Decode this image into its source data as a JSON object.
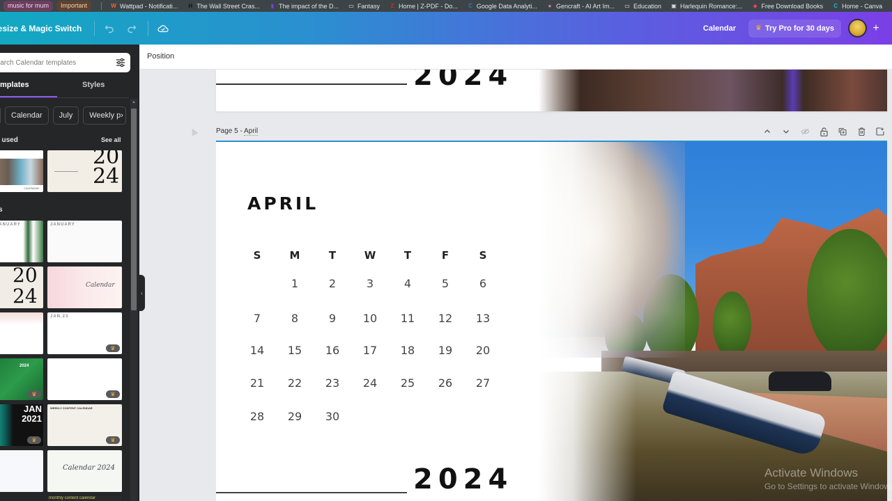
{
  "browser": {
    "bookmarks": [
      {
        "label": "music for mum",
        "kind": "pill",
        "color": "#6b3e5e"
      },
      {
        "label": "Important",
        "kind": "pill",
        "color": "#5c4230"
      },
      {
        "label": "Wattpad - Notificati...",
        "icon": "wattpad-icon",
        "glyph": "W",
        "color": "#ff6122"
      },
      {
        "label": "The Wall Street Cras...",
        "icon": "h-letter-icon",
        "glyph": "H",
        "color": "#111111"
      },
      {
        "label": "The impact of the D...",
        "icon": "bookmark-color-icon",
        "glyph": "▮",
        "color": "#7b3fe6"
      },
      {
        "label": "Fantasy",
        "icon": "folder-icon",
        "glyph": "▭",
        "color": "#e3e6e8"
      },
      {
        "label": "Home | Z-PDF - Do...",
        "icon": "zpdf-icon",
        "glyph": "Z",
        "color": "#e02424"
      },
      {
        "label": "Google Data Analyti...",
        "icon": "coursera-icon",
        "glyph": "C",
        "color": "#2a73cc"
      },
      {
        "label": "Gencraft - AI Art Im...",
        "icon": "gencraft-icon",
        "glyph": "●",
        "color": "#f07aa8"
      },
      {
        "label": "Education",
        "icon": "folder-icon",
        "glyph": "▭",
        "color": "#e3e6e8"
      },
      {
        "label": "Harlequin Romance:...",
        "icon": "harlequin-icon",
        "glyph": "▣",
        "color": "#dddddd"
      },
      {
        "label": "Free Download Books",
        "icon": "books-icon",
        "glyph": "◆",
        "color": "#e04848"
      },
      {
        "label": "Home - Canva",
        "icon": "canva-icon",
        "glyph": "C",
        "color": "#1fb5d6"
      }
    ]
  },
  "toolbar": {
    "resize_label": "Resize & Magic Switch",
    "undo_icon": "undo-icon",
    "redo_icon": "redo-icon",
    "save_status_icon": "cloud-check-icon",
    "doc_title": "Calendar",
    "try_pro_label": "Try Pro for 30 days",
    "share_plus": "+"
  },
  "sidebar": {
    "search_placeholder": "Search Calendar templates",
    "tabs": [
      {
        "label": "Templates",
        "active": true
      },
      {
        "label": "Styles",
        "active": false
      }
    ],
    "chips": [
      "Calendar",
      "July",
      "Weekly p"
    ],
    "chips_more": "›",
    "recent_heading": "Recently used",
    "see_all": "See all",
    "all_heading": "All results",
    "recent_thumbs": [
      {
        "name": "paris-photo-calendar",
        "caption": "CALENDAR"
      },
      {
        "name": "2024-minimal-calendar",
        "caption": "2024"
      }
    ],
    "template_thumbs": [
      {
        "name": "green-january-calendar",
        "title": "JANUARY",
        "premium": false
      },
      {
        "name": "gray-january-calendar",
        "title": "JANUARY",
        "premium": false
      },
      {
        "name": "2024-serif-calendar",
        "title": "2024",
        "premium": false
      },
      {
        "name": "cute-girl-calendar",
        "title": "Calendar",
        "premium": false
      },
      {
        "name": "pink-cat-calendar",
        "title": "",
        "premium": false
      },
      {
        "name": "jan-23-photo-calendar",
        "title": "JAN.23",
        "premium": true
      },
      {
        "name": "green-2024-calendar",
        "title": "2024",
        "premium": true
      },
      {
        "name": "minimal-planner-calendar",
        "title": "",
        "premium": true
      },
      {
        "name": "jan-2021-aurora-calendar",
        "title": "JAN 2021",
        "premium": true
      },
      {
        "name": "weekly-content-calendar",
        "title": "WEEKLY CONTENT CALENDAR",
        "premium": true
      },
      {
        "name": "photo-grid-calendar",
        "title": "",
        "premium": false
      },
      {
        "name": "leaf-calendar-2024",
        "title": "Calendar 2024",
        "premium": false
      }
    ],
    "partial_thumb_label": "monthly content calendar"
  },
  "editor": {
    "position_label": "Position",
    "previous_page": {
      "year": "2024"
    },
    "page_label": "Page 5 - ",
    "page_name": "April",
    "page_tools": [
      "move-up",
      "move-down",
      "hide",
      "lock",
      "duplicate",
      "delete",
      "add-page"
    ],
    "page": {
      "month": "APRIL",
      "year": "2024",
      "weekdays": [
        "S",
        "M",
        "T",
        "W",
        "T",
        "F",
        "S"
      ],
      "weeks": [
        [
          "",
          "1",
          "2",
          "3",
          "4",
          "5",
          "6"
        ],
        [
          "7",
          "8",
          "9",
          "10",
          "11",
          "12",
          "13"
        ],
        [
          "14",
          "15",
          "16",
          "17",
          "18",
          "19",
          "20"
        ],
        [
          "21",
          "22",
          "23",
          "24",
          "25",
          "26",
          "27"
        ],
        [
          "28",
          "29",
          "30",
          "",
          "",
          "",
          ""
        ]
      ],
      "photo": "amsterdam-canal-photo"
    }
  },
  "watermark": {
    "line1": "Activate Windows",
    "line2": "Go to Settings to activate Windows."
  },
  "colors": {
    "accent": "#8b5cf6",
    "topbar_start": "#12a8c2",
    "topbar_end": "#7b3fe6",
    "panel_bg": "#252627",
    "crown": "#f7b733"
  }
}
